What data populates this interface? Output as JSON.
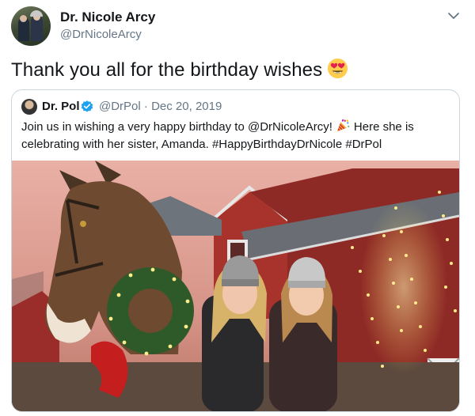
{
  "author": {
    "name": "Dr. Nicole Arcy",
    "handle": "@DrNicoleArcy",
    "avatar": "avatar-photo"
  },
  "tweet": {
    "text": "Thank you all for the birthday wishes",
    "emoji": "heart-eyes-emoji"
  },
  "quoted_tweet": {
    "author_name": "Dr. Pol",
    "verified": true,
    "handle": "@DrPol",
    "separator": "·",
    "date": "Dec 20, 2019",
    "text_line1_a": "Join us in wishing a very happy birthday to @DrNicoleArcy!",
    "text_line1_b": "Here she is",
    "text_line2": "celebrating with her sister, Amanda. #HappyBirthdayDrNicole #DrPol",
    "emoji": "party-popper-emoji",
    "media": "photo-two-women-with-horse-statue-and-christmas-lights"
  },
  "colors": {
    "text": "#14171a",
    "secondary": "#657786",
    "verified": "#1da1f2",
    "border": "#ccd6dd"
  }
}
